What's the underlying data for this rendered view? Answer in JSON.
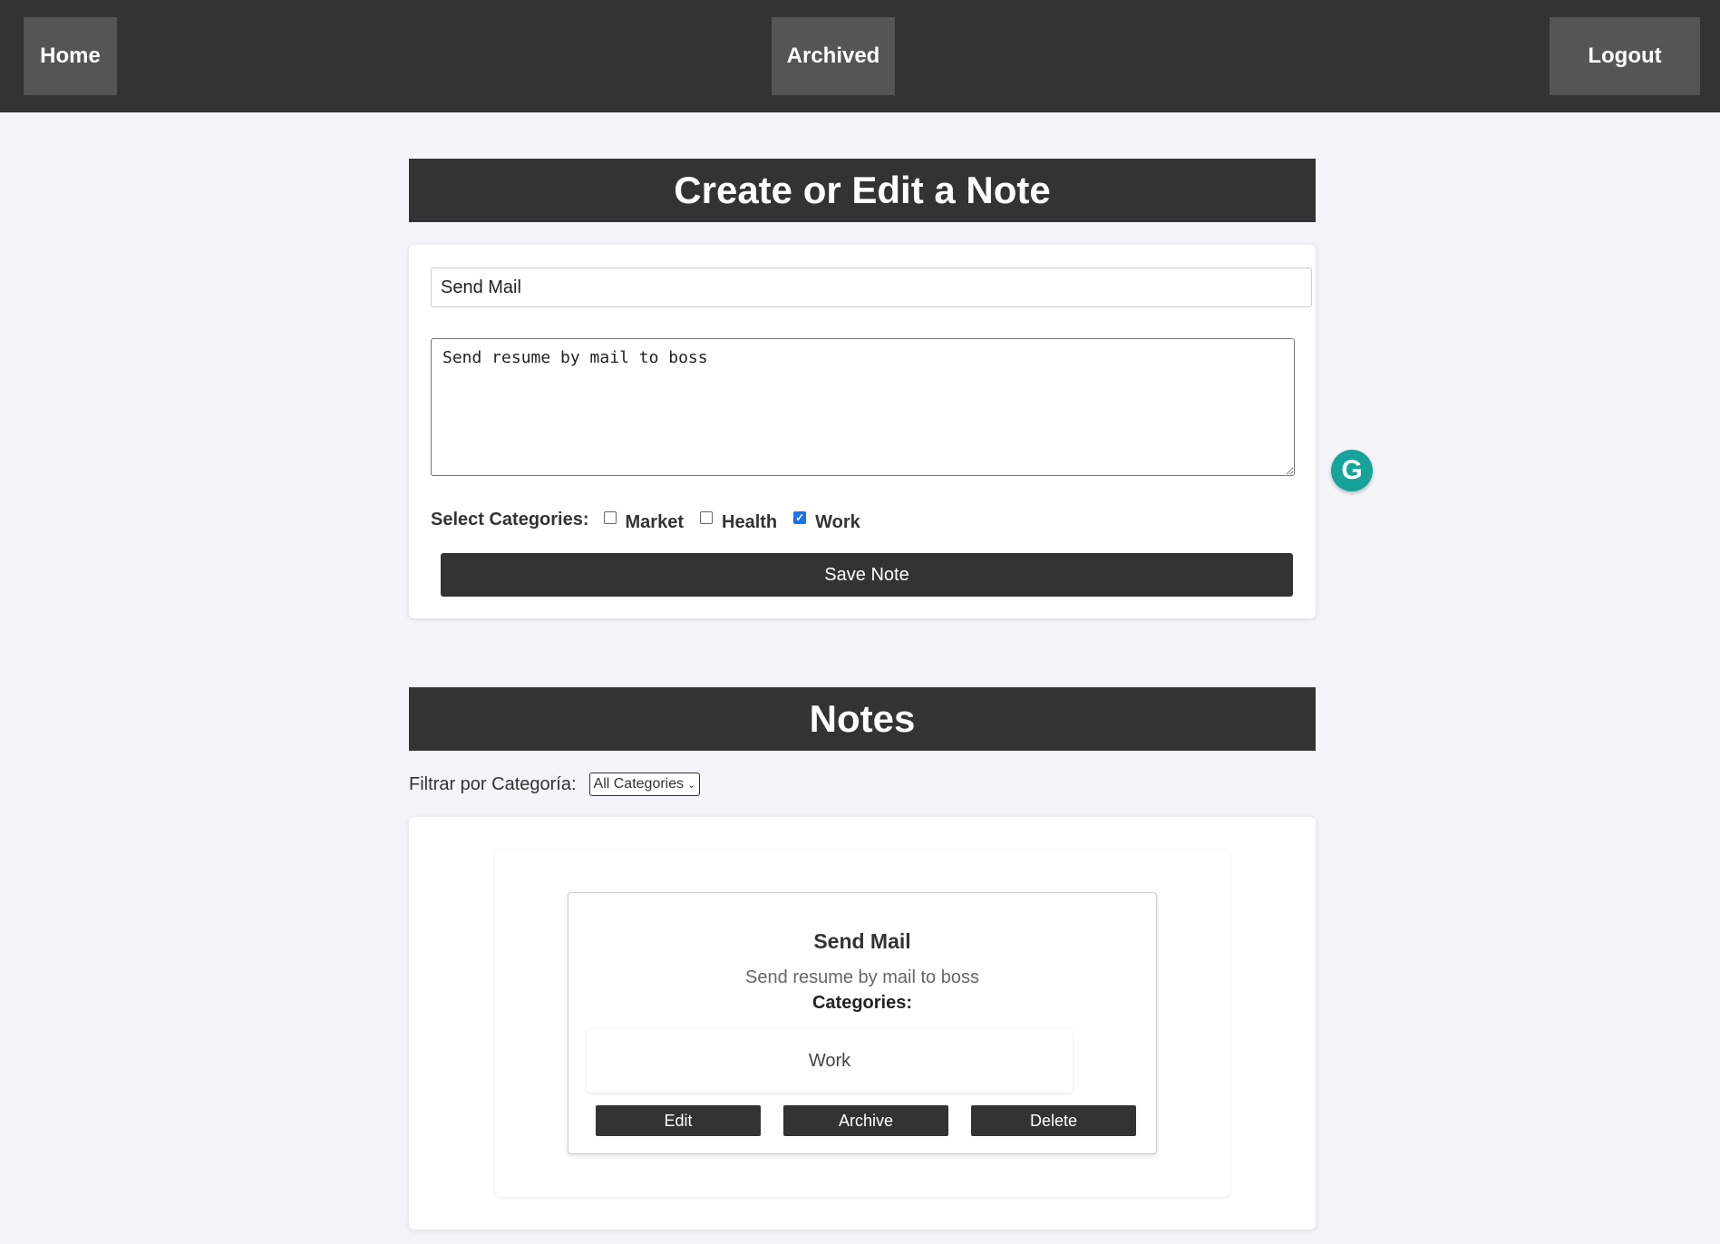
{
  "nav": {
    "home": "Home",
    "archived": "Archived",
    "logout": "Logout"
  },
  "form": {
    "header": "Create or Edit a Note",
    "title_value": "Send Mail",
    "content_value": "Send resume by mail to boss",
    "categories_label": "Select Categories:",
    "categories": [
      {
        "label": "Market",
        "checked": false
      },
      {
        "label": "Health",
        "checked": false
      },
      {
        "label": "Work",
        "checked": true
      }
    ],
    "save_label": "Save Note"
  },
  "notes": {
    "header": "Notes",
    "filter_label": "Filtrar por Categoría:",
    "filter_selected": "All Categories",
    "items": [
      {
        "title": "Send Mail",
        "content": "Send resume by mail to boss",
        "categories_label": "Categories:",
        "categories": [
          "Work"
        ],
        "edit_label": "Edit",
        "archive_label": "Archive",
        "delete_label": "Delete"
      }
    ]
  },
  "extension": {
    "grammarly_glyph": "G",
    "icon": "grammarly-icon",
    "color": "#15a39a"
  }
}
